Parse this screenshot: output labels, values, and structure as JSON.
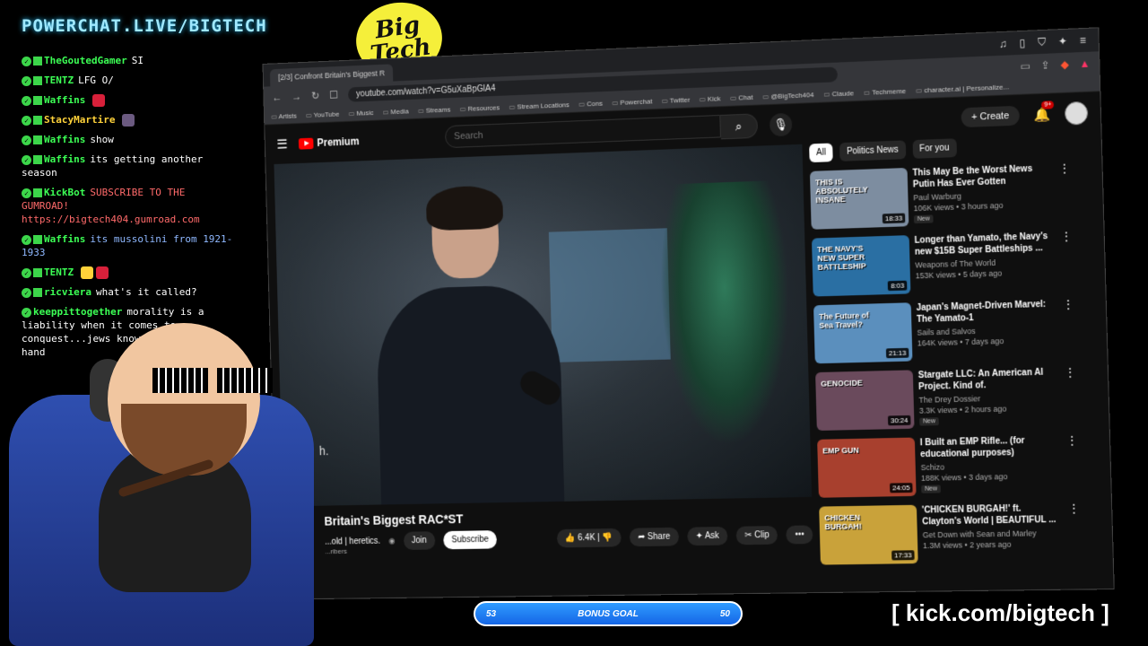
{
  "overlay": {
    "brand": "POWERCHAT.LIVE/BIGTECH",
    "logo_text": "Big Tech",
    "kick_url": "[ kick.com/bigtech ]",
    "bonus": {
      "left": "53",
      "label": "BONUS GOAL",
      "right": "50"
    }
  },
  "chat": [
    {
      "user": "TheGoutedGamer",
      "text": "SI"
    },
    {
      "user": "TENTZ",
      "text": "LFG O/"
    },
    {
      "user": "Waffins",
      "text": ""
    },
    {
      "user": "StacyMartire",
      "text": ""
    },
    {
      "user": "Waffins",
      "text": "show"
    },
    {
      "user": "Waffins",
      "text": "its getting another season"
    },
    {
      "user": "KickBot",
      "text": "SUBSCRIBE TO THE GUMROAD! https://bigtech404.gumroad.com"
    },
    {
      "user": "Waffins",
      "text": "its mussolini from 1921-1933"
    },
    {
      "user": "TENTZ",
      "text": ""
    },
    {
      "user": "ricviera",
      "text": "what's it called?"
    },
    {
      "user": "keeppittogether",
      "text": "morality is a liability when it comes to conquest...jews know they use it do hand"
    }
  ],
  "browser": {
    "tab_title": "[2/3] Confront Britain's Biggest R",
    "url": "youtube.com/watch?v=G5uXaBpGlA4",
    "bookmarks": [
      "Artists",
      "YouTube",
      "Music",
      "Media",
      "Streams",
      "Resources",
      "Stream Locations",
      "Cons",
      "Powerchat",
      "Twitter",
      "Kick",
      "Chat",
      "@BigTech404",
      "Claude",
      "Techmeme",
      "character.ai | Personalize..."
    ]
  },
  "youtube": {
    "logo": "Premium",
    "search_placeholder": "Search",
    "create_label": "Create",
    "notif_count": "9+",
    "cursor_char": "h.",
    "video": {
      "title": "Britain's Biggest RAC*ST",
      "channel": "...old | heretics.",
      "subs": "...ribers",
      "join": "Join",
      "subscribe": "Subscribe",
      "likes": "6.4K",
      "share": "Share",
      "ask": "Ask",
      "clip": "Clip",
      "more": "•••"
    },
    "chips": [
      "All",
      "Politics News",
      "For you"
    ],
    "recommendations": [
      {
        "title": "This May Be the Worst News Putin Has Ever Gotten",
        "channel": "Paul Warburg",
        "views": "106K views • 3 hours ago",
        "duration": "18:33",
        "new": "New",
        "thumb_text": "THIS IS ABSOLUTELY INSANE",
        "color": "#7d8da0"
      },
      {
        "title": "Longer than Yamato, the Navy's new $15B Super Battleships ...",
        "channel": "Weapons of The World",
        "views": "153K views • 5 days ago",
        "duration": "8:03",
        "new": "",
        "thumb_text": "THE NAVY'S NEW SUPER BATTLESHIP",
        "color": "#2a6fa3"
      },
      {
        "title": "Japan's Magnet-Driven Marvel: The Yamato-1",
        "channel": "Sails and Salvos",
        "views": "164K views • 7 days ago",
        "duration": "21:13",
        "new": "",
        "thumb_text": "The Future of Sea Travel?",
        "color": "#5b8fbd"
      },
      {
        "title": "Stargate LLC: An American AI Project. Kind of.",
        "channel": "The Drey Dossier",
        "views": "3.3K views • 2 hours ago",
        "duration": "30:24",
        "new": "New",
        "thumb_text": "GENOCIDE",
        "color": "#6a4a5c"
      },
      {
        "title": "I Built an EMP Rifle... (for educational purposes)",
        "channel": "Schizo",
        "views": "188K views • 3 days ago",
        "duration": "24:05",
        "new": "New",
        "thumb_text": "EMP GUN",
        "color": "#a8402e"
      },
      {
        "title": "'CHICKEN BURGAH!' ft. Clayton's World | BEAUTIFUL ...",
        "channel": "Get Down with Sean and Marley",
        "views": "1.3M views • 2 years ago",
        "duration": "17:33",
        "new": "",
        "thumb_text": "CHICKEN BURGAH!",
        "color": "#c9a23a"
      }
    ]
  },
  "colors": {
    "accent_green": "#3cff55",
    "youtube_red": "#ff0000",
    "bonus_blue": "#1566e6"
  }
}
